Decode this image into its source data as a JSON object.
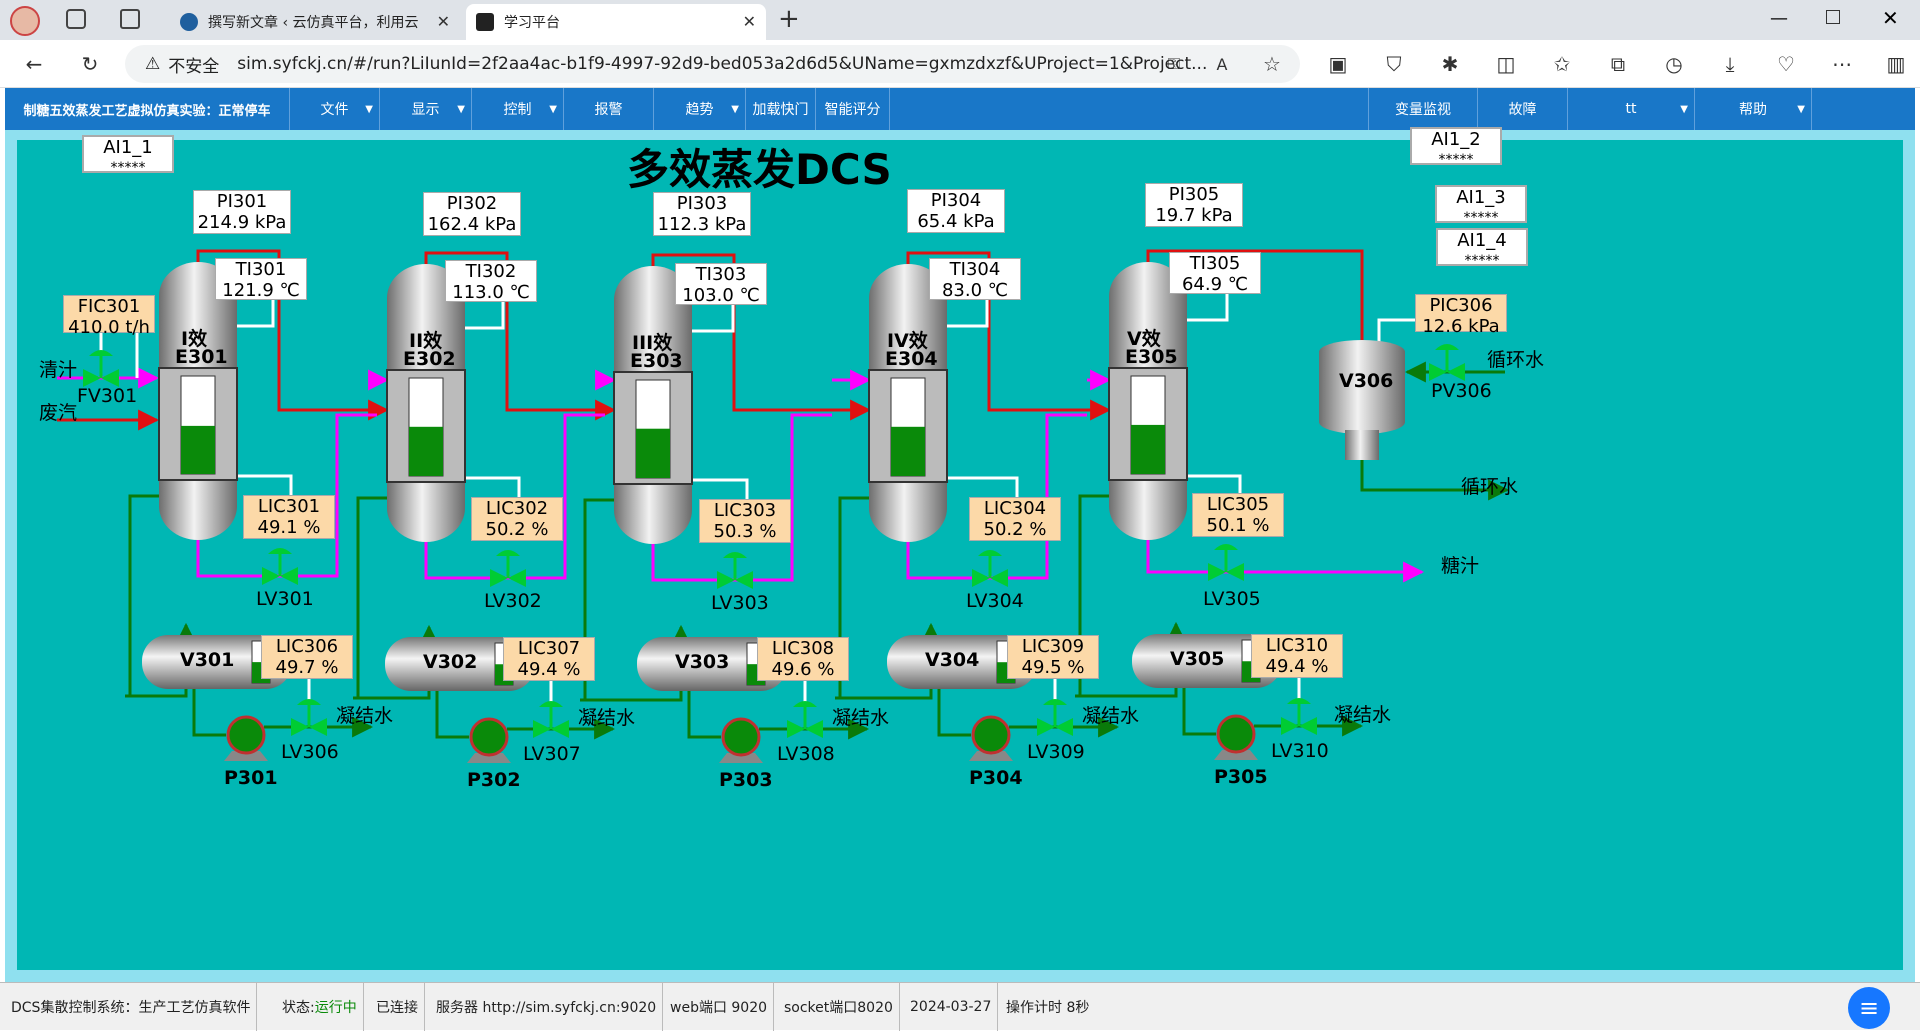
{
  "browser": {
    "tabs": [
      {
        "title": "撰写新文章 ‹ 云仿真平台，利用云"
      },
      {
        "title": "学习平台"
      }
    ],
    "security": "不安全",
    "url": "sim.syfckj.cn/#/run?LiIunId=2f2aa4ac-b1f9-4997-92d9-bed053a2d6d5&UName=gxmzdxzf&UProject=1&Project..."
  },
  "menu": {
    "title": "制糖五效蒸发工艺虚拟仿真实验：正常停车",
    "items": [
      "文件",
      "显示",
      "控制",
      "报警",
      "趋势",
      "加载快门",
      "智能评分",
      "变量监视",
      "故障",
      "tt",
      "帮助"
    ]
  },
  "page": {
    "title": "多效蒸发DCS"
  },
  "ai_boxes": [
    {
      "tag": "AI1_1",
      "value": "*****"
    },
    {
      "tag": "AI1_2",
      "value": "*****"
    },
    {
      "tag": "AI1_3",
      "value": "*****"
    },
    {
      "tag": "AI1_4",
      "value": "*****"
    }
  ],
  "effects": [
    {
      "name": "I效",
      "id": "E301",
      "pi_tag": "PI301",
      "pi_value": "214.9",
      "pi_unit": "kPa",
      "ti_tag": "TI301",
      "ti_value": "121.9",
      "ti_unit": "℃",
      "lic_tag": "LIC301",
      "lic_value": "49.1",
      "lic_unit": "%",
      "valve": "LV301",
      "level": 49.1
    },
    {
      "name": "II效",
      "id": "E302",
      "pi_tag": "PI302",
      "pi_value": "162.4",
      "pi_unit": "kPa",
      "ti_tag": "TI302",
      "ti_value": "113.0",
      "ti_unit": "℃",
      "lic_tag": "LIC302",
      "lic_value": "50.2",
      "lic_unit": "%",
      "valve": "LV302",
      "level": 50.2
    },
    {
      "name": "III效",
      "id": "E303",
      "pi_tag": "PI303",
      "pi_value": "112.3",
      "pi_unit": "kPa",
      "ti_tag": "TI303",
      "ti_value": "103.0",
      "ti_unit": "℃",
      "lic_tag": "LIC303",
      "lic_value": "50.3",
      "lic_unit": "%",
      "valve": "LV303",
      "level": 50.3
    },
    {
      "name": "IV效",
      "id": "E304",
      "pi_tag": "PI304",
      "pi_value": "65.4",
      "pi_unit": "kPa",
      "ti_tag": "TI304",
      "ti_value": "83.0",
      "ti_unit": "℃",
      "lic_tag": "LIC304",
      "lic_value": "50.2",
      "lic_unit": "%",
      "valve": "LV304",
      "level": 50.2
    },
    {
      "name": "V效",
      "id": "E305",
      "pi_tag": "PI305",
      "pi_value": "19.7",
      "pi_unit": "kPa",
      "ti_tag": "TI305",
      "ti_value": "64.9",
      "ti_unit": "℃",
      "lic_tag": "LIC305",
      "lic_value": "50.1",
      "lic_unit": "%",
      "valve": "LV305",
      "level": 50.1
    }
  ],
  "separators": [
    {
      "id": "V301",
      "lic_tag": "LIC306",
      "lic_value": "49.7",
      "lic_unit": "%",
      "valve": "LV306",
      "pump": "P301",
      "level": 49.7
    },
    {
      "id": "V302",
      "lic_tag": "LIC307",
      "lic_value": "49.4",
      "lic_unit": "%",
      "valve": "LV307",
      "pump": "P302",
      "level": 49.4
    },
    {
      "id": "V303",
      "lic_tag": "LIC308",
      "lic_value": "49.6",
      "lic_unit": "%",
      "valve": "LV308",
      "pump": "P303",
      "level": 49.6
    },
    {
      "id": "V304",
      "lic_tag": "LIC309",
      "lic_value": "49.5",
      "lic_unit": "%",
      "valve": "LV309",
      "pump": "P304",
      "level": 49.5
    },
    {
      "id": "V305",
      "lic_tag": "LIC310",
      "lic_value": "49.4",
      "lic_unit": "%",
      "valve": "LV310",
      "pump": "P305",
      "level": 49.4
    }
  ],
  "feed": {
    "fic_tag": "FIC301",
    "fic_value": "410.0",
    "fic_unit": "t/h",
    "valve": "FV301",
    "juice": "清汁",
    "steam": "废汽"
  },
  "condenser": {
    "id": "V306",
    "pic_tag": "PIC306",
    "pic_value": "12.6",
    "pic_unit": "kPa",
    "valve": "PV306",
    "water_in": "循环水",
    "water_out": "循环水"
  },
  "streams": {
    "condensate": "凝结水",
    "product": "糖汁"
  },
  "statusbar": {
    "system": "DCS集散控制系统：生产工艺仿真软件",
    "state_label": "状态:",
    "state_value": "运行中",
    "connected": "已连接",
    "server": "服务器 http://sim.syfckj.cn:9020",
    "web": "web端口 9020",
    "socket": "socket端口8020",
    "date": "2024-03-27",
    "timer": "操作计时 8秒"
  },
  "colors": {
    "background": "#00b7b4",
    "steam": "#e01010",
    "juice": "#ff00ff",
    "condensate": "#0a7a0a",
    "level": "#0a8a0a",
    "label_bg": "#fcd9a8"
  }
}
